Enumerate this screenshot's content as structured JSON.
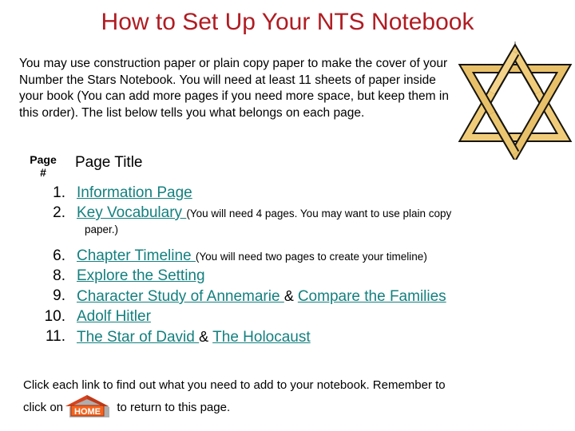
{
  "slide": {
    "title": "How to Set Up Your NTS Notebook",
    "intro": "You may use construction paper or plain copy paper to make the cover of your Number the Stars Notebook.  You will need at least 11 sheets of paper inside your book (You can add more pages if you need more space, but keep them in this order). The list below tells you what belongs on each page.",
    "colors": {
      "title_red": "#b01c22",
      "link_teal": "#14807f",
      "star_gold": "#f0cc7a",
      "star_outline": "#1a1a14",
      "home_roof": "#c03a18",
      "home_body": "#f4641e"
    }
  },
  "table": {
    "header_pagenum_line1": "Page",
    "header_pagenum_line2": "#",
    "header_pagetitle": "Page Title",
    "rows": [
      {
        "number": "1.",
        "links": [
          "Information Page"
        ],
        "separator": "",
        "note": "",
        "note_line2": ""
      },
      {
        "number": "2.",
        "links": [
          "Key Vocabulary "
        ],
        "separator": "",
        "note": "(You will need 4 pages.  You may want to use plain copy",
        "note_line2": "paper.)"
      },
      {
        "number": "6.",
        "links": [
          "Chapter Timeline "
        ],
        "separator": "",
        "note": "(You will need two pages to create your timeline)",
        "note_line2": ""
      },
      {
        "number": "8.",
        "links": [
          "Explore the Setting"
        ],
        "separator": "",
        "note": "",
        "note_line2": ""
      },
      {
        "number": "9.",
        "links": [
          "Character Study of Annemarie ",
          "Compare the Families"
        ],
        "separator": "&",
        "note": "",
        "note_line2": ""
      },
      {
        "number": "10.",
        "links": [
          "Adolf Hitler"
        ],
        "separator": "",
        "note": "",
        "note_line2": ""
      },
      {
        "number": "11.",
        "links": [
          "The Star of David ",
          "The Holocaust"
        ],
        "separator": "&",
        "note": "",
        "note_line2": ""
      }
    ]
  },
  "footer": {
    "line1": "Click each link to find out what you need to add to your notebook. Remember to",
    "line2_before": "click on",
    "line2_after": " to return to this page.",
    "home_icon_label": "HOME"
  }
}
